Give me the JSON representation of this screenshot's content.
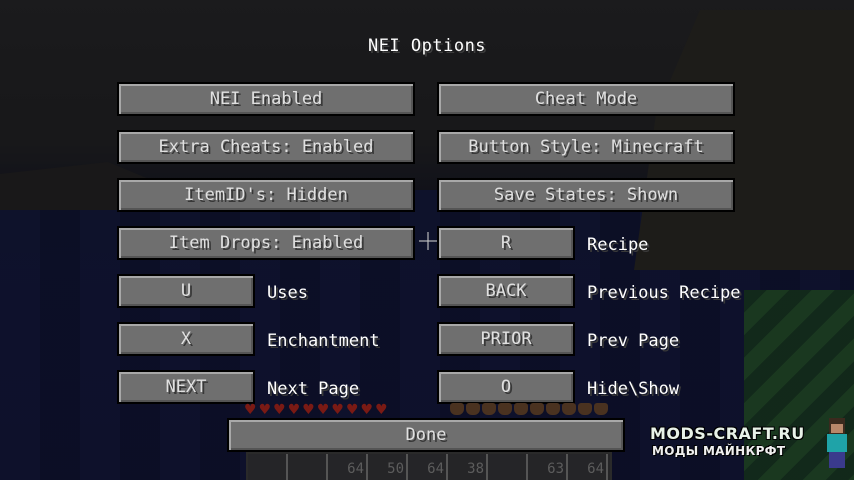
{
  "screen": {
    "title": "NEI Options"
  },
  "buttons": {
    "nei_enabled": "NEI Enabled",
    "cheat_mode": "Cheat Mode",
    "extra_cheats": "Extra Cheats: Enabled",
    "button_style": "Button Style: Minecraft",
    "item_ids": "ItemID's: Hidden",
    "save_states": "Save States: Shown",
    "item_drops": "Item Drops: Enabled",
    "done": "Done"
  },
  "keybinds": [
    {
      "key": "R",
      "action": "Recipe"
    },
    {
      "key": "U",
      "action": "Uses"
    },
    {
      "key": "BACK",
      "action": "Previous Recipe"
    },
    {
      "key": "X",
      "action": "Enchantment"
    },
    {
      "key": "PRIOR",
      "action": "Prev Page"
    },
    {
      "key": "NEXT",
      "action": "Next Page"
    },
    {
      "key": "O",
      "action": "Hide\\Show"
    }
  ],
  "hud": {
    "hearts": 10,
    "armor": 10,
    "hotbar_counts": [
      "",
      "",
      "64",
      "50",
      "64",
      "38",
      "",
      "63",
      "64"
    ]
  },
  "watermark": {
    "site": "MODS-CRAFT.RU",
    "tagline": "МОДЫ МАЙНКРФТ"
  },
  "colors": {
    "button_face": "#6f6f6f",
    "button_text": "#e0e0e0",
    "title_text": "#ffffff"
  }
}
